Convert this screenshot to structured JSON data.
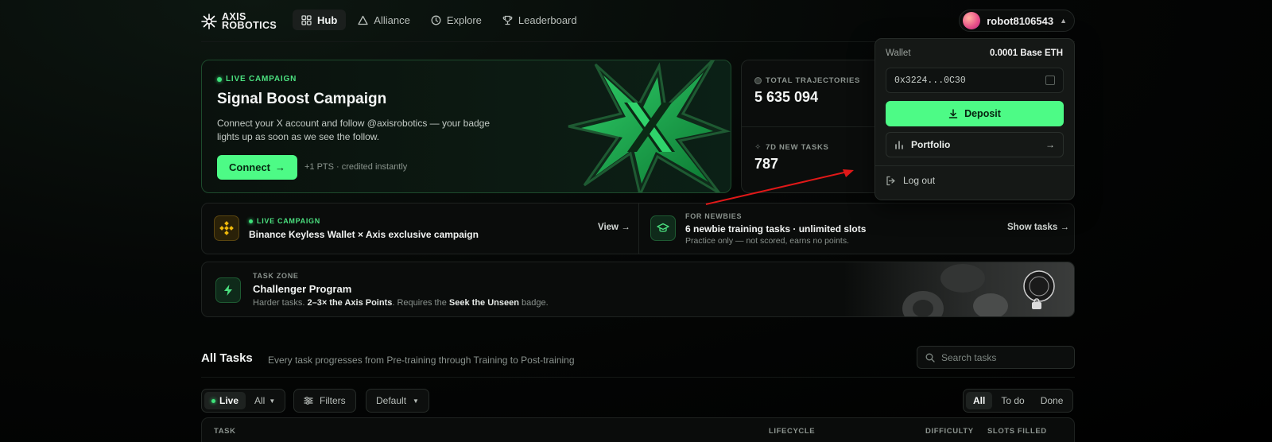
{
  "brand": {
    "line1": "AXIS",
    "line2": "ROBOTICS"
  },
  "nav": {
    "items": [
      {
        "label": "Hub",
        "icon": "grid-icon",
        "active": true
      },
      {
        "label": "Alliance",
        "icon": "triangle-icon"
      },
      {
        "label": "Explore",
        "icon": "compass-icon"
      },
      {
        "label": "Leaderboard",
        "icon": "trophy-icon"
      }
    ]
  },
  "user": {
    "name": "robot8106543",
    "caret": "▲"
  },
  "hero": {
    "tag": "LIVE CAMPAIGN",
    "title": "Signal Boost Campaign",
    "description": "Connect your X account and follow @axisrobotics — your badge lights up as soon as we see the follow.",
    "button": "Connect",
    "points_note": "+1 PTS · credited instantly"
  },
  "stats": {
    "total_label": "TOTAL TRAJECTORIES",
    "total_value": "5 635 094",
    "new_label": "7D NEW TASKS",
    "new_value": "787"
  },
  "wallet_menu": {
    "wallet_label": "Wallet",
    "balance": "0.0001 Base ETH",
    "address": "0x3224...0C30",
    "deposit": "Deposit",
    "portfolio": "Portfolio",
    "logout": "Log out"
  },
  "binance": {
    "tag": "LIVE CAMPAIGN",
    "title": "Binance Keyless Wallet × Axis exclusive campaign",
    "link": "View"
  },
  "newbies": {
    "tag": "FOR NEWBIES",
    "title": "6 newbie training tasks · unlimited slots",
    "subtitle": "Practice only — not scored, earns no points.",
    "link": "Show tasks"
  },
  "task_zone": {
    "tag": "TASK ZONE",
    "title": "Challenger Program",
    "desc_1": "Harder tasks. ",
    "desc_2": "2–3× the Axis Points",
    "desc_3": ". Requires the ",
    "desc_4": "Seek the Unseen",
    "desc_5": " badge."
  },
  "all_tasks": {
    "title": "All Tasks",
    "subtitle": "Every task progresses from Pre-training through Training to Post-training",
    "search_placeholder": "Search tasks"
  },
  "filters": {
    "live": "Live",
    "all": "All",
    "filters": "Filters",
    "sort": "Default",
    "status_tabs": [
      "All",
      "To do",
      "Done"
    ]
  },
  "table": {
    "columns": [
      "TASK",
      "LIFECYCLE",
      "DIFFICULTY",
      "SLOTS FILLED"
    ]
  },
  "colors": {
    "accent": "#4dfb86",
    "live": "#3ee27a",
    "annotation_arrow": "#e01818"
  }
}
